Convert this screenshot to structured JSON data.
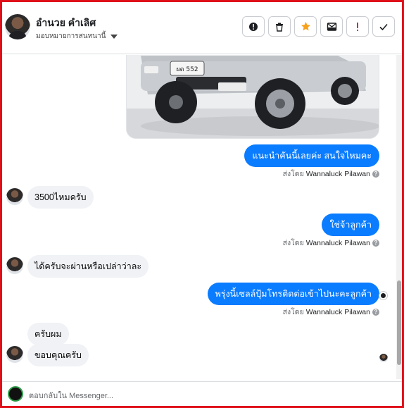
{
  "header": {
    "name": "อำนวย คำเลิศ",
    "assign_label": "มอบหมายการสนทนานี้",
    "actions": [
      {
        "name": "alert-circle-icon",
        "glyph": "!"
      },
      {
        "name": "trash-icon",
        "glyph": "🗑"
      },
      {
        "name": "star-icon",
        "glyph": "★"
      },
      {
        "name": "archive-mail-icon",
        "glyph": "✉"
      },
      {
        "name": "mark-spam-icon",
        "glyph": "!"
      },
      {
        "name": "check-icon",
        "glyph": "✓"
      }
    ]
  },
  "messages": {
    "m1": "แนะนำคันนี้เลยค่ะ สนใจไหมคะ",
    "m2": "3500ไหมครับ",
    "m3": "ใช่จ้าลูกค้า",
    "m4": "ได้ครับจะผ่านหรือเปล่าว่าละ",
    "m5": "พรุ่งนี้เซลล์ปุ้มโทรติดต่อเข้าไปนะคะลูกค้า",
    "m6": "ครับผม",
    "m7": "ขอบคุณครับ"
  },
  "sent_by": {
    "prefix": "ส่งโดย",
    "agent": "Wannaluck Pilawan"
  },
  "car_image": {
    "plate": "ผต 552"
  },
  "composer": {
    "placeholder": "ตอบกลับใน Messenger..."
  },
  "colors": {
    "outgoing": "#0a7cff",
    "incoming": "#f0f2f5",
    "frame": "#e0101a",
    "star": "#f7a11a",
    "spam": "#e41e3f"
  }
}
